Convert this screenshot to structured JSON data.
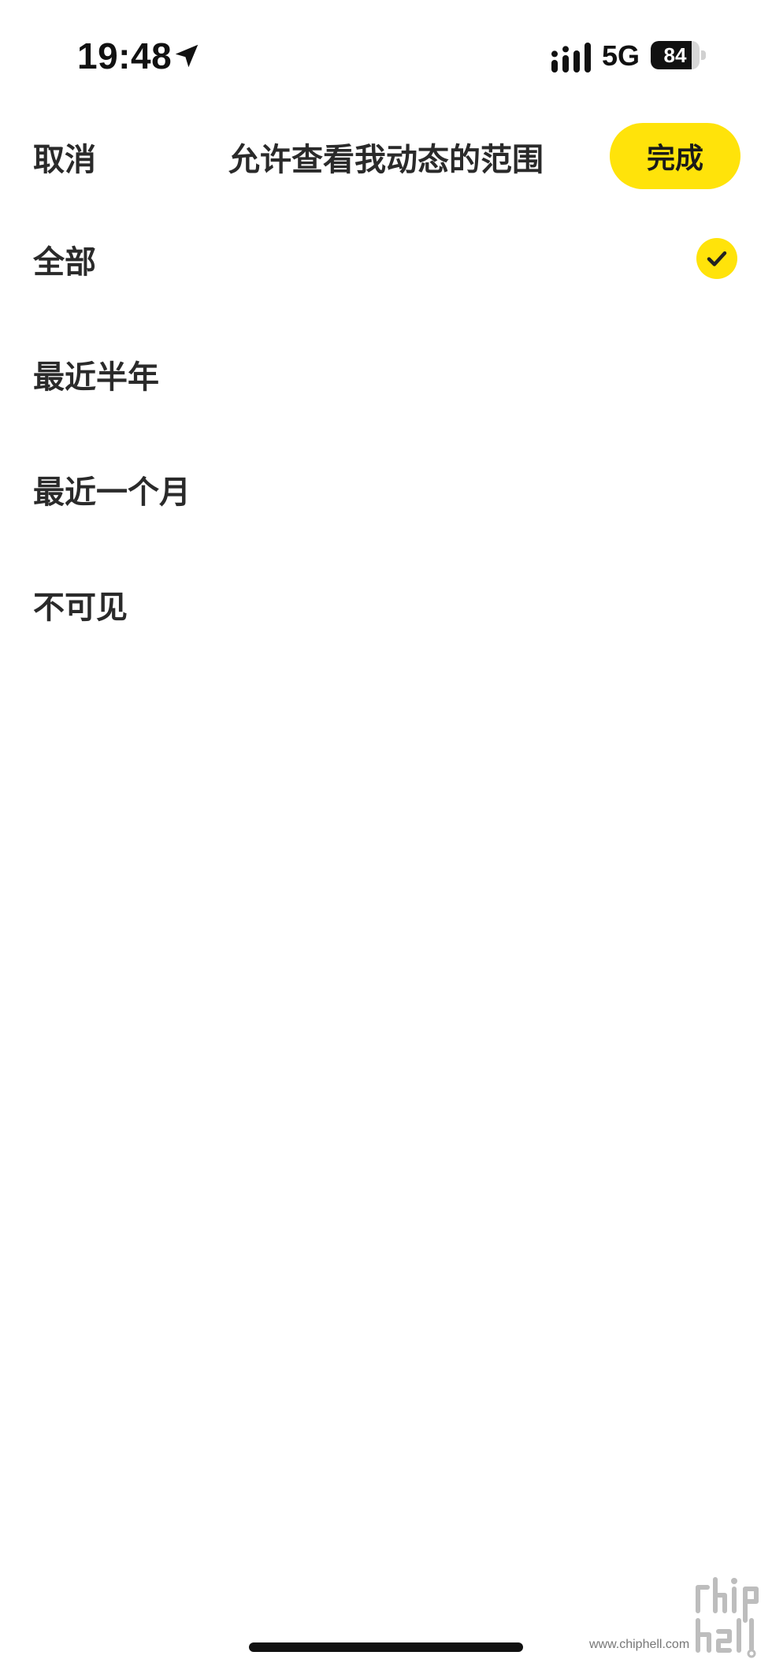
{
  "status_bar": {
    "time": "19:48",
    "network": "5G",
    "battery_level": "84",
    "battery_fraction": 0.84,
    "icons": [
      "location-arrow-icon",
      "signal-icon",
      "battery-icon"
    ]
  },
  "header": {
    "cancel_label": "取消",
    "title": "允许查看我动态的范围",
    "done_label": "完成"
  },
  "options": [
    {
      "label": "全部",
      "selected": true
    },
    {
      "label": "最近半年",
      "selected": false
    },
    {
      "label": "最近一个月",
      "selected": false
    },
    {
      "label": "不可见",
      "selected": false
    }
  ],
  "colors": {
    "accent": "#FFE30A",
    "text": "#2A2A2A",
    "background": "#FFFFFF"
  },
  "watermark": {
    "text": "www.chiphell.com"
  }
}
